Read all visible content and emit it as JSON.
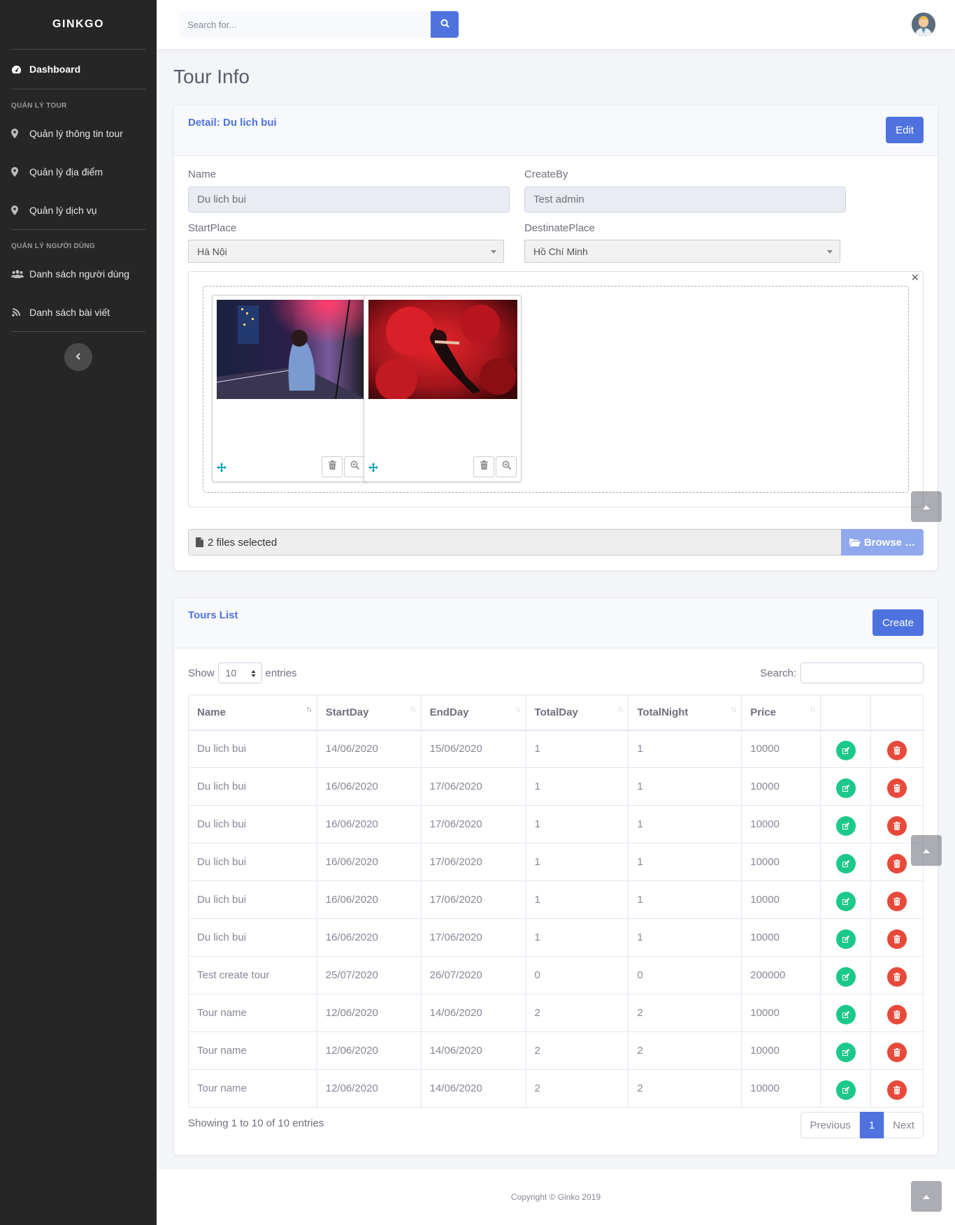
{
  "sidebar": {
    "brand": "GINKGO",
    "dashboard": "Dashboard",
    "heading_tour": "QUẢN LÝ TOUR",
    "tour_items": [
      {
        "label": "Quản lý thông tin tour"
      },
      {
        "label": "Quản lý địa điểm"
      },
      {
        "label": "Quản lý dịch vụ"
      }
    ],
    "heading_user": "QUẢN LÝ NGƯỜI DÙNG",
    "user_items": [
      {
        "label": "Danh sách người dùng"
      },
      {
        "label": "Danh sách bài viết"
      }
    ]
  },
  "topbar": {
    "search_placeholder": "Search for..."
  },
  "page": {
    "title": "Tour Info"
  },
  "detail": {
    "title": "Detail: Du lich bui",
    "edit_label": "Edit",
    "name_label": "Name",
    "name_value": "Du lich bui",
    "createby_label": "CreateBy",
    "createby_value": "Test admin",
    "startplace_label": "StartPlace",
    "startplace_value": "Hà Nội",
    "destplace_label": "DestinatePlace",
    "destplace_value": "Hồ Chí Minh",
    "files_caption": "2 files selected",
    "browse_label": "Browse …",
    "close_symbol": "×"
  },
  "tours": {
    "title": "Tours List",
    "create_label": "Create",
    "show_label": "Show",
    "page_length": "10",
    "entries_label": "entries",
    "search_label": "Search:",
    "columns": [
      "Name",
      "StartDay",
      "EndDay",
      "TotalDay",
      "TotalNight",
      "Price"
    ],
    "rows": [
      [
        "Du lich bui",
        "14/06/2020",
        "15/06/2020",
        "1",
        "1",
        "10000"
      ],
      [
        "Du lich bui",
        "16/06/2020",
        "17/06/2020",
        "1",
        "1",
        "10000"
      ],
      [
        "Du lich bui",
        "16/06/2020",
        "17/06/2020",
        "1",
        "1",
        "10000"
      ],
      [
        "Du lich bui",
        "16/06/2020",
        "17/06/2020",
        "1",
        "1",
        "10000"
      ],
      [
        "Du lich bui",
        "16/06/2020",
        "17/06/2020",
        "1",
        "1",
        "10000"
      ],
      [
        "Du lich bui",
        "16/06/2020",
        "17/06/2020",
        "1",
        "1",
        "10000"
      ],
      [
        "Test create tour",
        "25/07/2020",
        "26/07/2020",
        "0",
        "0",
        "200000"
      ],
      [
        "Tour name",
        "12/06/2020",
        "14/06/2020",
        "2",
        "2",
        "10000"
      ],
      [
        "Tour name",
        "12/06/2020",
        "14/06/2020",
        "2",
        "2",
        "10000"
      ],
      [
        "Tour name",
        "12/06/2020",
        "14/06/2020",
        "2",
        "2",
        "10000"
      ]
    ],
    "info": "Showing 1 to 10 of 10 entries",
    "prev_label": "Previous",
    "page_number": "1",
    "next_label": "Next"
  },
  "footer": {
    "text": "Copyright © Ginko 2019"
  },
  "colors": {
    "primary": "#4e73df",
    "sidebar": "#262626",
    "success": "#1cc88a",
    "danger": "#e74a3b"
  }
}
